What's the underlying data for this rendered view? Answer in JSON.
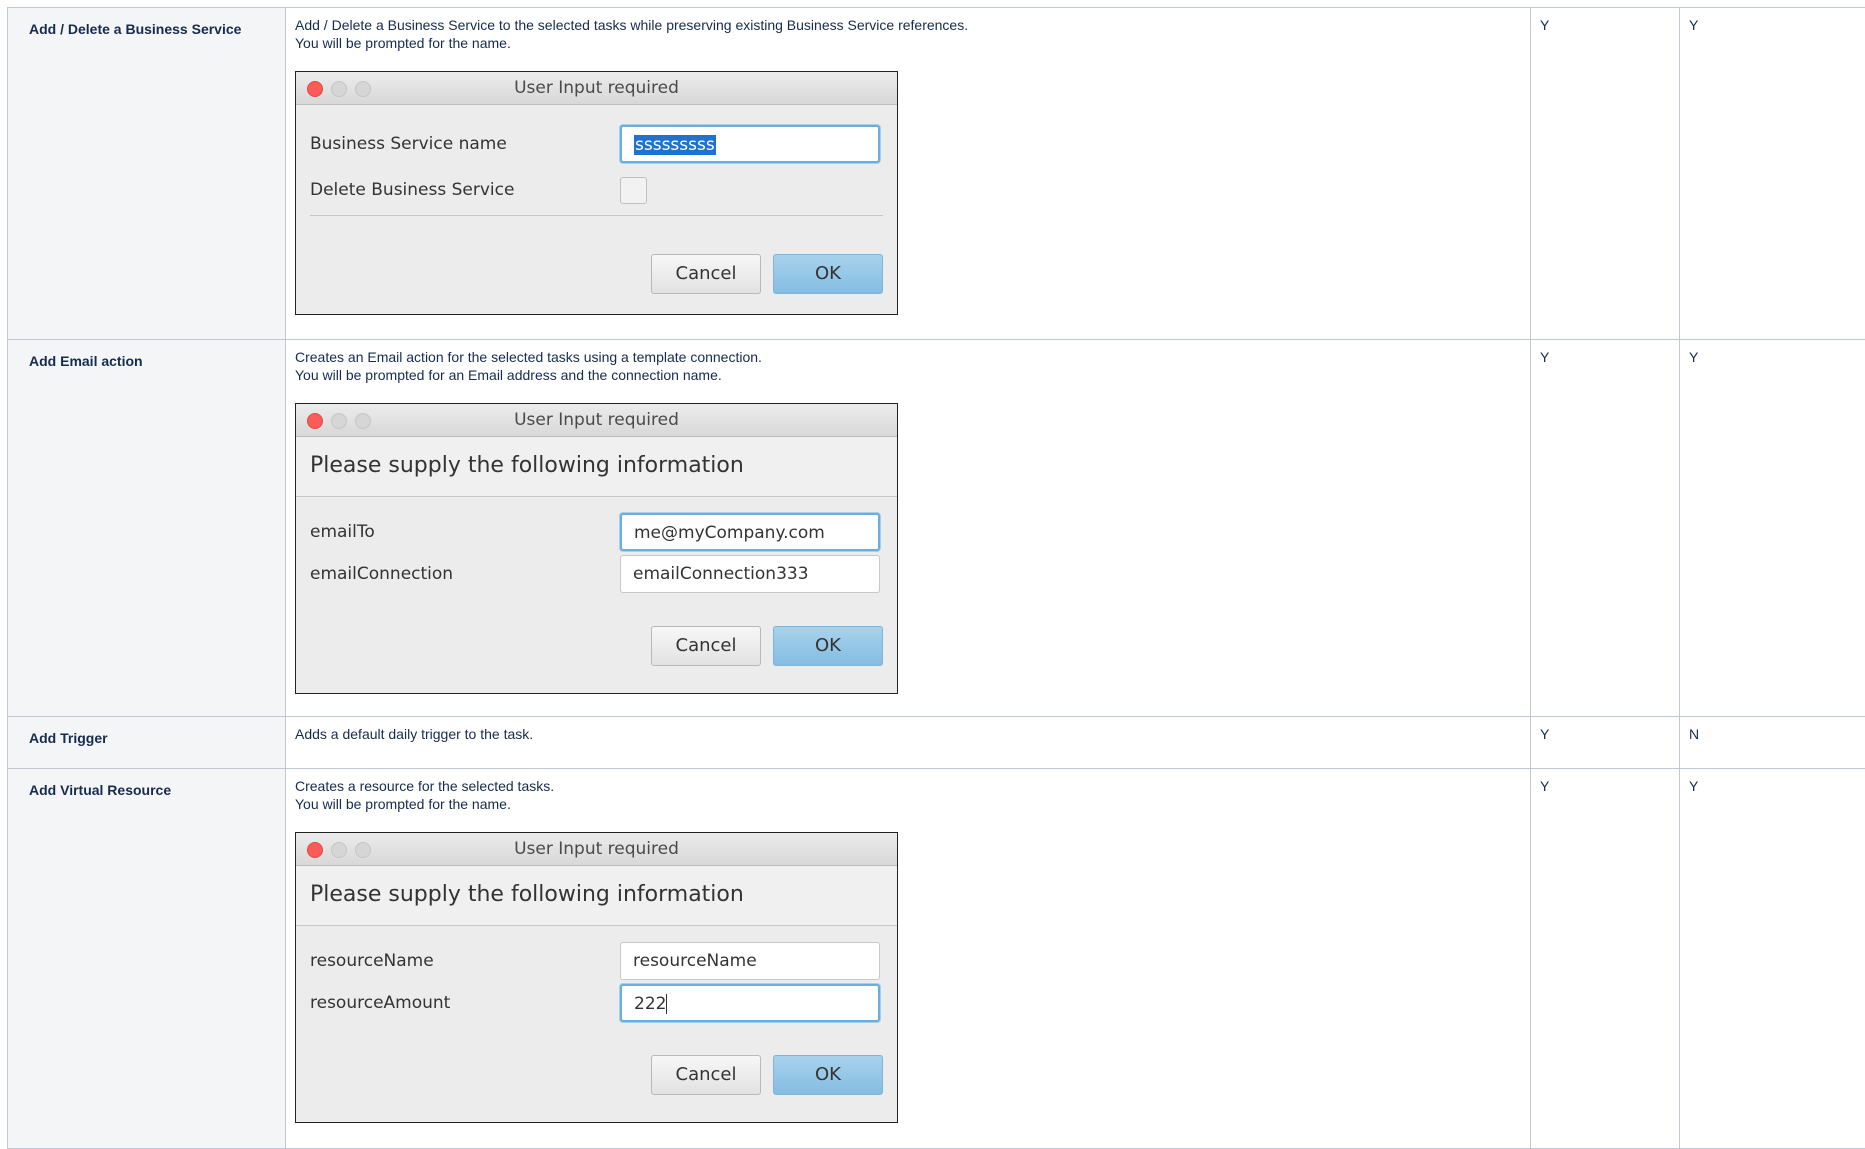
{
  "rows": [
    {
      "name": "Add / Delete a Business Service",
      "desc": [
        "Add / Delete a Business Service to the selected tasks while preserving existing Business Service references.",
        "You will be prompted for the name."
      ],
      "col3": "Y",
      "col4": "Y",
      "dialog": {
        "title": "User Input required",
        "field1_label": "Business Service name",
        "field1_value": "sssssssss",
        "check_label": "Delete Business Service",
        "cancel": "Cancel",
        "ok": "OK"
      }
    },
    {
      "name": "Add Email action",
      "desc": [
        "Creates an Email action for the selected tasks using a template connection.",
        "You will be prompted for an Email address and the connection name."
      ],
      "col3": "Y",
      "col4": "Y",
      "dialog": {
        "title": "User Input required",
        "info": "Please supply the following information",
        "field1_label": "emailTo",
        "field1_value": "me@myCompany.com",
        "field2_label": "emailConnection",
        "field2_value": "emailConnection333",
        "cancel": "Cancel",
        "ok": "OK"
      }
    },
    {
      "name": "Add Trigger",
      "desc": [
        "Adds a default daily trigger to the task."
      ],
      "col3": "Y",
      "col4": "N"
    },
    {
      "name": "Add Virtual Resource",
      "desc": [
        "Creates a resource for the selected tasks.",
        "You will be prompted for the name."
      ],
      "col3": "Y",
      "col4": "Y",
      "dialog": {
        "title": "User Input required",
        "info": "Please supply the following information",
        "field1_label": "resourceName",
        "field1_value": "resourceName",
        "field2_label": "resourceAmount",
        "field2_value": "222",
        "cancel": "Cancel",
        "ok": "OK"
      }
    }
  ]
}
